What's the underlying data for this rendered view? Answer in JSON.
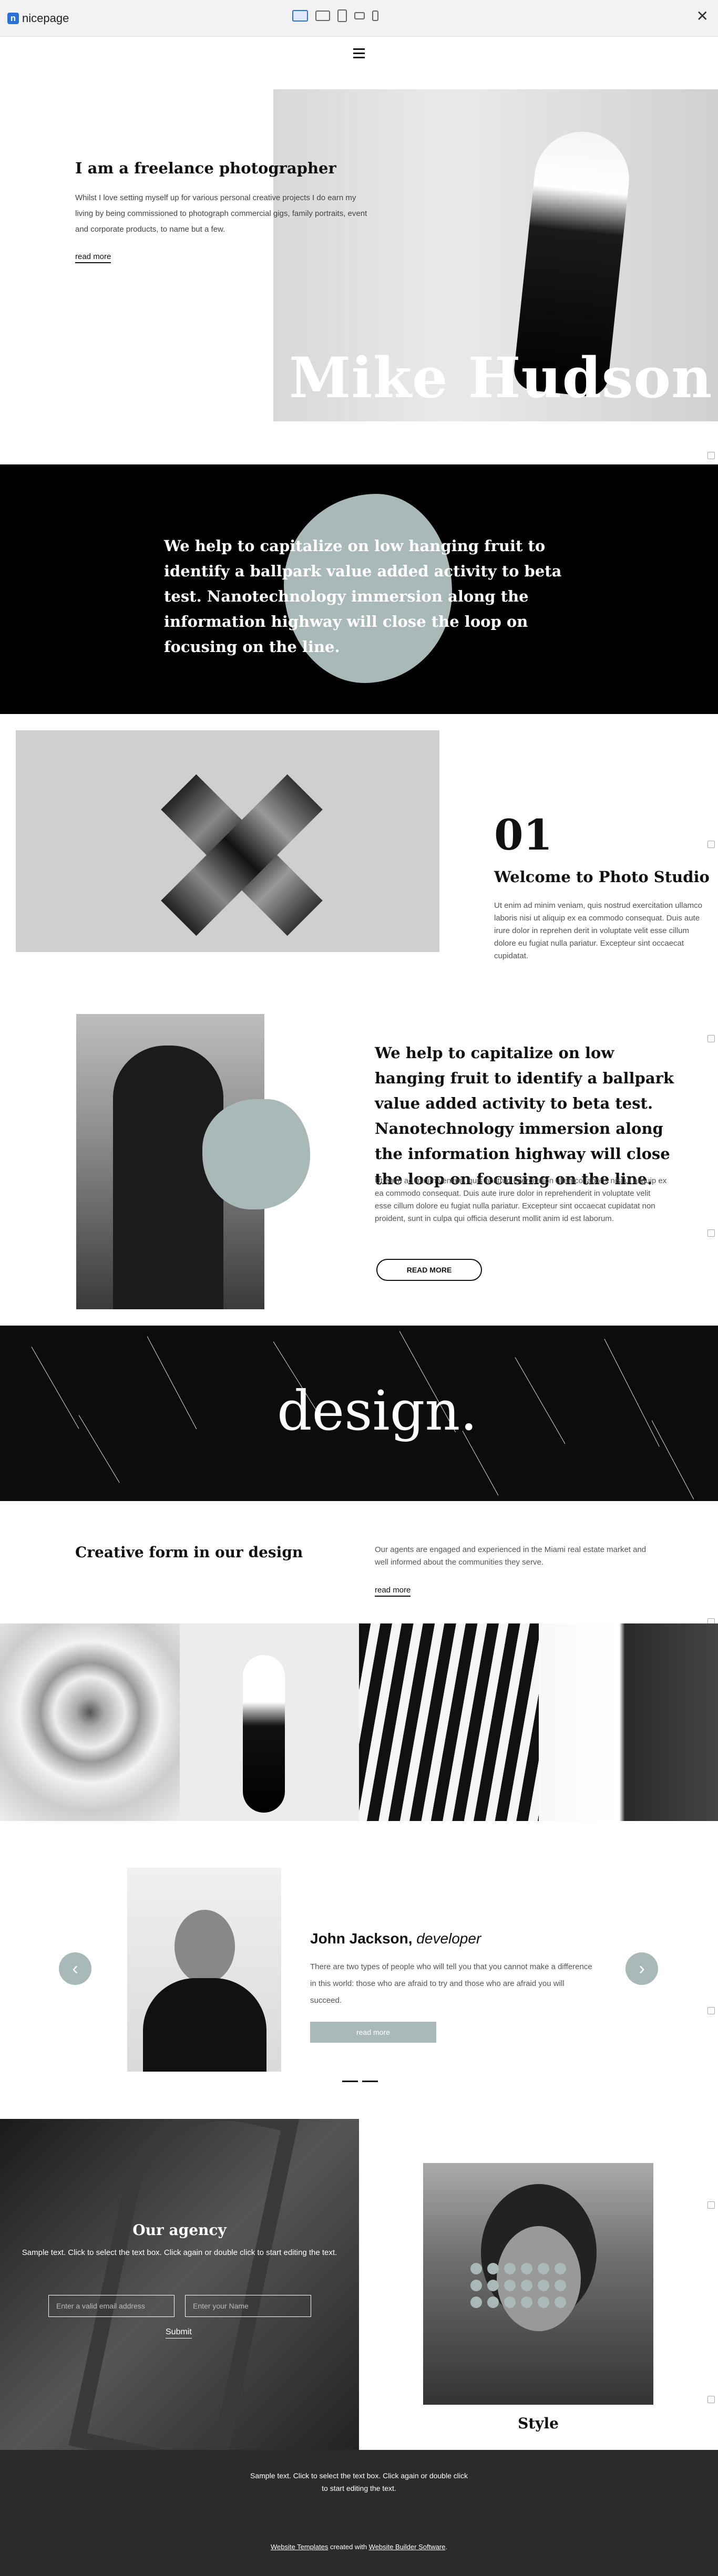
{
  "toolbar": {
    "brand": "nicepage",
    "brand_letter": "n",
    "devices": [
      "desktop-icon",
      "laptop-icon",
      "tablet-landscape-icon",
      "tablet-portrait-icon",
      "phone-icon"
    ],
    "close": "✕"
  },
  "hero": {
    "heading": "I am a freelance photographer",
    "text": "Whilst I love setting myself up for various personal creative projects I do earn my living by being commissioned to photograph commercial gigs, family portraits, event and corporate products, to name but a few.",
    "link": "read more",
    "name": "Mike Hudson"
  },
  "black_band": {
    "text": "We help to capitalize on low hanging fruit to identify a ballpark value added activity to beta test. Nanotechnology immersion along the information highway will close the loop on focusing on the line."
  },
  "studio": {
    "number": "01",
    "heading": "Welcome to Photo Studio",
    "text": "Ut enim ad minim veniam, quis nostrud exercitation ullamco laboris nisi ut aliquip ex ea commodo consequat. Duis aute irure dolor in reprehen derit in voluptate velit esse cillum dolore eu fugiat nulla pariatur. Excepteur sint occaecat cupidatat."
  },
  "about": {
    "heading": "We help to capitalize on low hanging fruit to identify a ballpark value added activity to beta test. Nanotechnology immersion along the information highway will close the loop on focusing on the line.",
    "text": "Ut enim ad minim veniam, quis nostrud exercitation ullamco laboris nisi ut aliquip ex ea commodo consequat. Duis aute irure dolor in reprehenderit in voluptate velit esse cillum dolore eu fugiat nulla pariatur. Excepteur sint occaecat cupidatat non proident, sunt in culpa qui officia deserunt mollit anim id est laborum.",
    "button": "READ MORE"
  },
  "design": {
    "word": "design."
  },
  "creative": {
    "heading": "Creative form in our design",
    "text": "Our agents are engaged and experienced in the Miami real estate market and well informed about the communities they serve.",
    "link": "read more"
  },
  "testimonial": {
    "name": "John Jackson,",
    "role": "developer",
    "text": "There are two types of people who will tell you that you cannot make a difference in this world: those who are afraid to try and those who are afraid you will succeed.",
    "button": "read more",
    "prev": "‹",
    "next": "›"
  },
  "agency": {
    "heading": "Our agency",
    "text": "Sample text. Click to select the text box. Click again or double click to start editing the text.",
    "email_placeholder": "Enter a valid email address",
    "name_placeholder": "Enter your Name",
    "submit": "Submit"
  },
  "style": {
    "label": "Style"
  },
  "footer": {
    "text": "Sample text. Click to select the text box. Click again or double click to start editing the text.",
    "link1": "Website Templates",
    "middle": " created with ",
    "link2": "Website Builder Software",
    "end": "."
  },
  "colors": {
    "accent": "#a8b9b7",
    "brand": "#2b6fd8",
    "footer_bg": "#2b2b2b"
  }
}
